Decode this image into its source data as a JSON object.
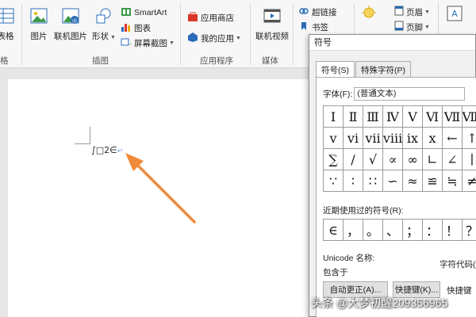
{
  "ribbon": {
    "table_label": "表格",
    "table_sub": "格",
    "picture_label": "图片",
    "online_picture_label": "联机图片",
    "shapes_label": "形状",
    "smartart_label": "SmartArt",
    "chart_label": "图表",
    "screenshot_label": "屏幕截图",
    "illustrations_group": "插图",
    "store_label": "应用商店",
    "my_apps_label": "我的应用",
    "apps_group": "应用程序",
    "online_video_label": "联机视频",
    "media_group": "媒体",
    "hyperlink_label": "超链接",
    "bookmark_label": "书签",
    "header_label": "页眉",
    "footer_label": "页脚",
    "colors": {
      "blue": "#2b6cb8",
      "red": "#d9372b",
      "orange": "#ee8b3a",
      "green": "#3c9a4b"
    }
  },
  "document": {
    "formula_text": "∫□2∈",
    "arrow_color": "#f08a3c"
  },
  "dialog": {
    "title": "符号",
    "tab_symbols": "符号(S)",
    "tab_special": "特殊字符(P)",
    "font_label": "字体(F):",
    "font_value": "(普通文本)",
    "symbols": [
      "Ⅰ",
      "Ⅱ",
      "Ⅲ",
      "Ⅳ",
      "Ⅴ",
      "Ⅵ",
      "Ⅶ",
      "Ⅷ",
      "ⅴ",
      "ⅵ",
      "ⅶ",
      "ⅷ",
      "ⅸ",
      "ⅹ",
      "←",
      "↑",
      "∑",
      "∕",
      "√",
      "∝",
      "∞",
      "∟",
      "∠",
      "∣",
      "∵",
      "∶",
      "∷",
      "∽",
      "≈",
      "≌",
      "≒",
      "≠"
    ],
    "recent_label": "近期使用过的符号(R):",
    "recent_symbols": [
      "∈",
      "，",
      "。",
      "、",
      "；",
      "：",
      "！",
      "？"
    ],
    "unicode_name_label": "Unicode 名称:",
    "contains_label": "包含于",
    "char_code_label": "字符代码(",
    "autocorrect_button": "自动更正(A)...",
    "shortcut_key_button": "快捷键(K)...",
    "shortcut_key_label": "快捷键"
  },
  "watermark": "头条 @大梦初醒209356965"
}
